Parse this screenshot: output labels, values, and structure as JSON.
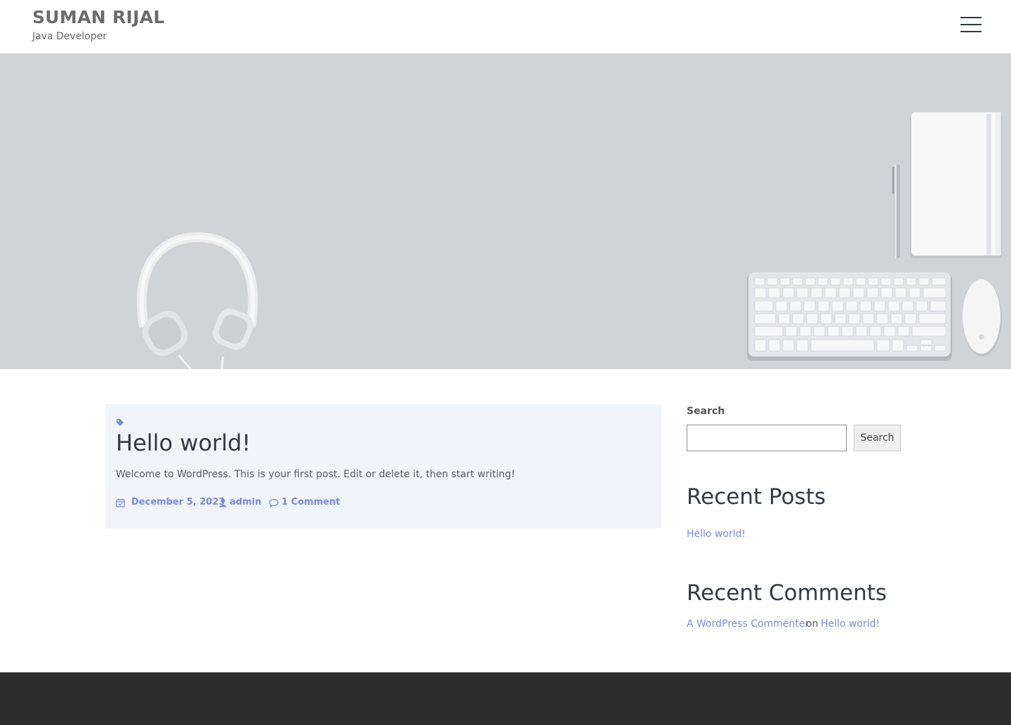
{
  "header": {
    "site_title": "SUMAN RIJAL",
    "tagline": "Java Developer",
    "menu_icon": "hamburger-menu-icon"
  },
  "hero": {
    "image_description": "desk flat-lay: headphones, pen, notebook, keyboard, mouse"
  },
  "post": {
    "tag_icon": "tag-icon",
    "title": "Hello world!",
    "excerpt": "Welcome to WordPress. This is your first post. Edit or delete it, then start writing!",
    "meta": {
      "date_icon": "calendar-check-icon",
      "date": "December 5, 2023",
      "author_icon": "user-icon",
      "author": "admin",
      "comments_icon": "comment-icon",
      "comments": "1 Comment"
    }
  },
  "sidebar": {
    "search": {
      "label": "Search",
      "input_value": "",
      "button_label": "Search"
    },
    "recent_posts": {
      "heading": "Recent Posts",
      "items": [
        "Hello world!"
      ]
    },
    "recent_comments": {
      "heading": "Recent Comments",
      "items": [
        {
          "author": "A WordPress Commenter",
          "connector": "on",
          "post": "Hello world!"
        }
      ]
    }
  },
  "colors": {
    "accent": "#7b88e0",
    "card_background": "#f0f5fa",
    "hero_background": "#d2d3d7",
    "footer_background": "#2d2d2d",
    "heading": "#333a44"
  }
}
